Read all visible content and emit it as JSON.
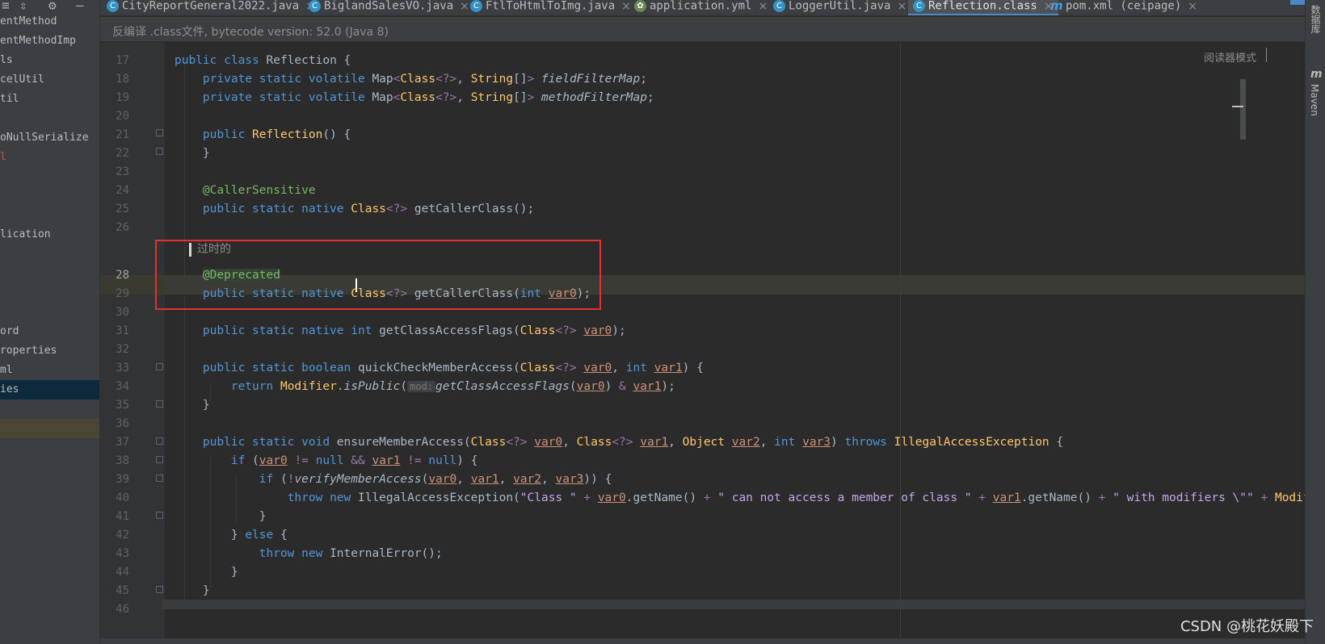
{
  "sidebar": {
    "toolbar_icons": [
      "collapse-icon",
      "gear-icon",
      "minimize-icon"
    ],
    "items": [
      {
        "label": "entMethod",
        "state": "normal"
      },
      {
        "label": "entMethodImp",
        "state": "normal"
      },
      {
        "label": "ls",
        "state": "normal"
      },
      {
        "label": "celUtil",
        "state": "normal"
      },
      {
        "label": "til",
        "state": "normal"
      },
      {
        "label": "",
        "state": "normal"
      },
      {
        "label": "oNullSerialize",
        "state": "normal"
      },
      {
        "label": "l",
        "state": "red"
      },
      {
        "label": "",
        "state": "normal"
      },
      {
        "label": "",
        "state": "normal"
      },
      {
        "label": "",
        "state": "normal"
      },
      {
        "label": "lication",
        "state": "normal"
      },
      {
        "label": "",
        "state": "normal"
      },
      {
        "label": "",
        "state": "normal"
      },
      {
        "label": "",
        "state": "normal"
      },
      {
        "label": "",
        "state": "normal"
      },
      {
        "label": "ord",
        "state": "normal"
      },
      {
        "label": "roperties",
        "state": "normal"
      },
      {
        "label": "ml",
        "state": "normal"
      },
      {
        "label": "ies",
        "state": "selected"
      },
      {
        "label": "",
        "state": "normal"
      },
      {
        "label": "",
        "state": "highlight"
      }
    ]
  },
  "tabs": [
    {
      "label": "CityReportGeneral2022.java",
      "icon": "C",
      "active": false
    },
    {
      "label": "BiglandSalesVO.java",
      "icon": "C",
      "active": false
    },
    {
      "label": "FtlToHtmlToImg.java",
      "icon": "C",
      "active": false
    },
    {
      "label": "application.yml",
      "icon": "yml",
      "active": false
    },
    {
      "label": "LoggerUtil.java",
      "icon": "C",
      "active": false
    },
    {
      "label": "Reflection.class",
      "icon": "C",
      "active": true
    },
    {
      "label": "pom.xml (ceipage)",
      "icon": "m",
      "active": false
    }
  ],
  "banner": {
    "text": "反编译 .class文件, bytecode version: 52.0 (Java 8)"
  },
  "editor": {
    "reader_mode": "阅读器模式",
    "doc_comment": "过时的",
    "line_numbers": [
      "17",
      "18",
      "19",
      "20",
      "21",
      "22",
      "23",
      "24",
      "25",
      "26",
      "",
      "28",
      "29",
      "30",
      "31",
      "32",
      "33",
      "34",
      "35",
      "36",
      "37",
      "38",
      "39",
      "40",
      "41",
      "42",
      "43",
      "44",
      "45",
      "46"
    ],
    "current_line": "28"
  },
  "right_strip": {
    "database": "数据库",
    "maven": "Maven"
  },
  "watermark": "CSDN @桃花妖殿下"
}
